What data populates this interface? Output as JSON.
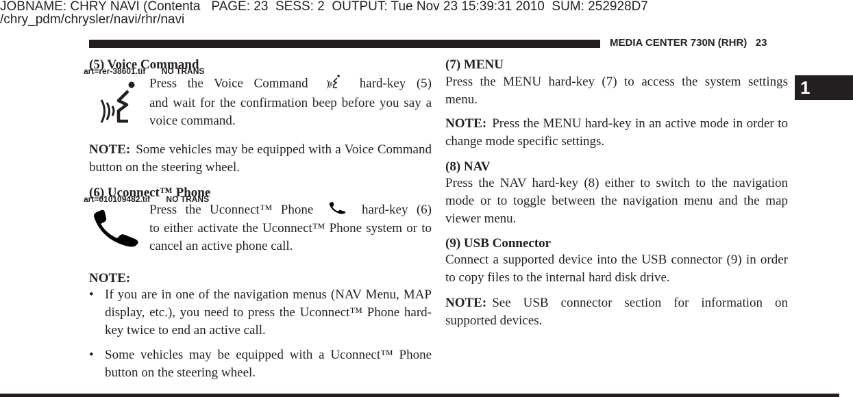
{
  "slug": {
    "line1": "JOBNAME: CHRY NAVI (Contenta   PAGE: 23  SESS: 2  OUTPUT: Tue Nov 23 15:39:31 2010  SUM: 252928D7",
    "line2": "/chry_pdm/chrysler/navi/rhr/navi"
  },
  "running_head": "MEDIA CENTER 730N (RHR)   23",
  "section_tab": "1",
  "left": {
    "voice": {
      "heading": "(5) Voice Command",
      "art_tag": "art=rer-38601.tif       NO TRANS",
      "icon": "voice-command-icon",
      "body_before": "Press the Voice Command",
      "body_after": "hard-key (5)",
      "body_rest": "and wait for the confirmation beep before you say a voice command.",
      "note_label": "NOTE:",
      "note_text": "Some vehicles may be equipped with a Voice Command button on the steering wheel."
    },
    "phone": {
      "heading": "(6) Uconnect™ Phone",
      "art_tag": "art=010109482.tif       NO TRANS",
      "icon": "phone-handset-icon",
      "body_before": "Press the Uconnect™ Phone",
      "body_after": "hard-key (6)",
      "body_rest": "to either activate the Uconnect™ Phone system or to cancel an active phone call.",
      "note_label": "NOTE:",
      "bullets": [
        "If you are in one of the navigation menus (NAV Menu, MAP display, etc.), you need to press the Uconnect™ Phone hard-key twice to end an active call.",
        "Some vehicles may be equipped with a Uconnect™ Phone button on the steering wheel."
      ],
      "bullet_glyph": "•"
    }
  },
  "right": {
    "menu": {
      "heading": "(7) MENU",
      "body": "Press the MENU hard-key (7) to access the system settings menu.",
      "note_label": "NOTE:",
      "note_text": "Press the MENU hard-key in an active mode in order to change mode specific settings."
    },
    "nav": {
      "heading": "(8) NAV",
      "body": "Press the NAV hard-key (8) either to switch to the navigation mode or to toggle between the navigation menu and the map viewer menu."
    },
    "usb": {
      "heading": "(9) USB Connector",
      "body": "Connect a supported device into the USB connector (9) in order to copy files to the internal hard disk drive.",
      "note_label": "NOTE:",
      "note_text": "See USB connector section for information on supported devices."
    }
  }
}
